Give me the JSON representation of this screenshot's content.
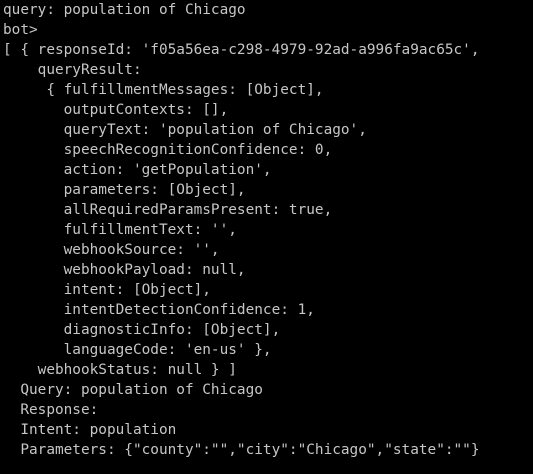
{
  "terminal": {
    "colors": {
      "background": "#000000",
      "foreground": "#c6c6c6"
    },
    "lines": [
      "query: population of Chicago",
      "bot>",
      "[ { responseId: 'f05a56ea-c298-4979-92ad-a996fa9ac65c',",
      "    queryResult:",
      "     { fulfillmentMessages: [Object],",
      "       outputContexts: [],",
      "       queryText: 'population of Chicago',",
      "       speechRecognitionConfidence: 0,",
      "       action: 'getPopulation',",
      "       parameters: [Object],",
      "       allRequiredParamsPresent: true,",
      "       fulfillmentText: '',",
      "       webhookSource: '',",
      "       webhookPayload: null,",
      "       intent: [Object],",
      "       intentDetectionConfidence: 1,",
      "       diagnosticInfo: [Object],",
      "       languageCode: 'en-us' },",
      "    webhookStatus: null } ]",
      "  Query: population of Chicago",
      "  Response:",
      "  Intent: population",
      "  Parameters: {\"county\":\"\",\"city\":\"Chicago\",\"state\":\"\"}"
    ]
  }
}
